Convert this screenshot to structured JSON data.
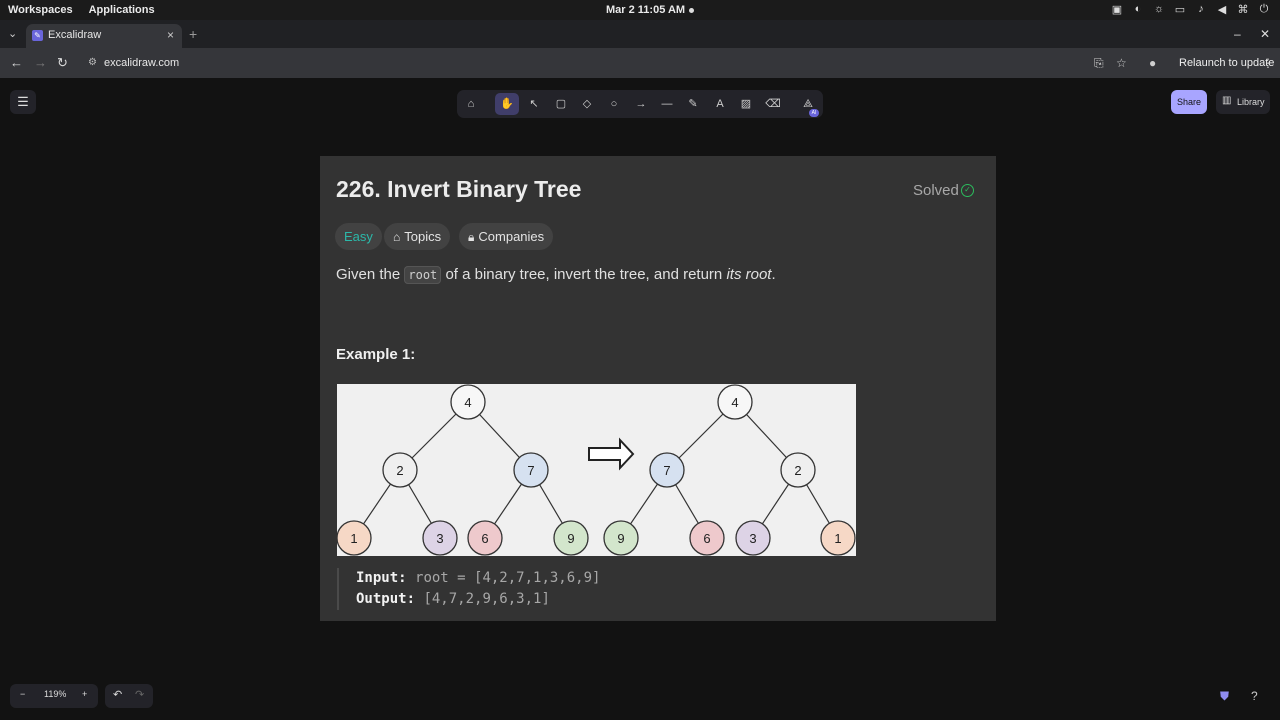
{
  "system": {
    "workspaces": "Workspaces",
    "applications": "Applications",
    "clock": "Mar 2  11:05 AM"
  },
  "browser": {
    "tab_title": "Excalidraw",
    "url": "excalidraw.com",
    "relaunch": "Relaunch to update"
  },
  "excalidraw": {
    "share_label": "Share",
    "library_label": "Library",
    "zoom_level": "119%",
    "ai_badge": "AI",
    "tools": [
      "lock",
      "hand",
      "selection",
      "rectangle",
      "diamond",
      "ellipse",
      "arrow",
      "line",
      "draw",
      "text",
      "image",
      "eraser",
      "more-tools"
    ],
    "tool_shortcuts": [
      "",
      "",
      "1",
      "2",
      "3",
      "4",
      "5",
      "6",
      "7",
      "8",
      "9",
      "0",
      ""
    ]
  },
  "problem": {
    "title": "226. Invert Binary Tree",
    "status": "Solved",
    "difficulty": "Easy",
    "topics": "Topics",
    "companies": "Companies",
    "desc_before": "Given the ",
    "desc_code": "root",
    "desc_middle": " of a binary tree, invert the tree, and return ",
    "desc_em": "its root",
    "desc_end": ".",
    "example_title": "Example 1:",
    "input_label": "Input:",
    "input_value": "root = [4,2,7,1,3,6,9]",
    "output_label": "Output:",
    "output_value": "[4,7,2,9,6,3,1]"
  },
  "tree_figure": {
    "left_tree": [
      "4",
      "2",
      "7",
      "1",
      "3",
      "6",
      "9"
    ],
    "right_tree": [
      "4",
      "7",
      "2",
      "9",
      "6",
      "3",
      "1"
    ],
    "node_colors": {
      "4": "#f7f7f7",
      "2": "#efefef",
      "7": "#d6e1f0",
      "1": "#f6d8c6",
      "3": "#ddd3e6",
      "6": "#eec9cc",
      "9": "#d3e6cc"
    }
  }
}
